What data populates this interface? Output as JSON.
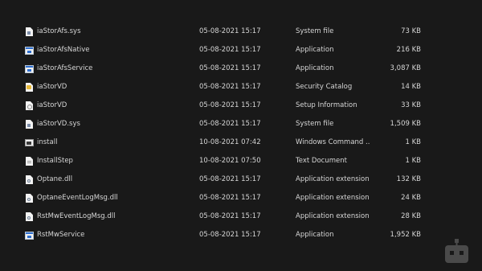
{
  "files": [
    {
      "icon": "system-file-icon",
      "name": "iaStorAfs.sys",
      "date": "05-08-2021 15:17",
      "type": "System file",
      "size": "73 KB"
    },
    {
      "icon": "application-icon",
      "name": "iaStorAfsNative",
      "date": "05-08-2021 15:17",
      "type": "Application",
      "size": "216 KB"
    },
    {
      "icon": "application-icon",
      "name": "iaStorAfsService",
      "date": "05-08-2021 15:17",
      "type": "Application",
      "size": "3,087 KB"
    },
    {
      "icon": "security-catalog-icon",
      "name": "iaStorVD",
      "date": "05-08-2021 15:17",
      "type": "Security Catalog",
      "size": "14 KB"
    },
    {
      "icon": "setup-information-icon",
      "name": "iaStorVD",
      "date": "05-08-2021 15:17",
      "type": "Setup Information",
      "size": "33 KB"
    },
    {
      "icon": "system-file-icon",
      "name": "iaStorVD.sys",
      "date": "05-08-2021 15:17",
      "type": "System file",
      "size": "1,509 KB"
    },
    {
      "icon": "windows-command-script-icon",
      "name": "install",
      "date": "10-08-2021 07:42",
      "type": "Windows Command ...",
      "size": "1 KB"
    },
    {
      "icon": "text-document-icon",
      "name": "InstallStep",
      "date": "10-08-2021 07:50",
      "type": "Text Document",
      "size": "1 KB"
    },
    {
      "icon": "application-extension-icon",
      "name": "Optane.dll",
      "date": "05-08-2021 15:17",
      "type": "Application extension",
      "size": "132 KB"
    },
    {
      "icon": "application-extension-icon",
      "name": "OptaneEventLogMsg.dll",
      "date": "05-08-2021 15:17",
      "type": "Application extension",
      "size": "24 KB"
    },
    {
      "icon": "application-extension-icon",
      "name": "RstMwEventLogMsg.dll",
      "date": "05-08-2021 15:17",
      "type": "Application extension",
      "size": "28 KB"
    },
    {
      "icon": "application-icon",
      "name": "RstMwService",
      "date": "05-08-2021 15:17",
      "type": "Application",
      "size": "1,952 KB"
    }
  ],
  "watermark": {
    "icon": "robot-logo-icon"
  },
  "colors": {
    "background": "#191919",
    "text": "#d6d6d6",
    "accent": "#2f6fd0"
  }
}
